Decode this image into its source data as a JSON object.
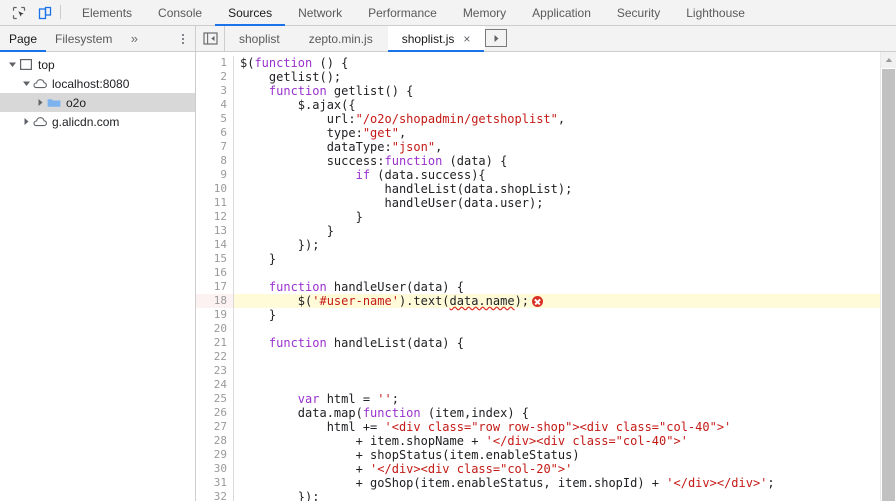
{
  "toolbar": {
    "inspect_icon": "inspect-element-icon",
    "device_icon": "device-toolbar-icon"
  },
  "main_tabs": [
    {
      "label": "Elements",
      "active": false
    },
    {
      "label": "Console",
      "active": false
    },
    {
      "label": "Sources",
      "active": true
    },
    {
      "label": "Network",
      "active": false
    },
    {
      "label": "Performance",
      "active": false
    },
    {
      "label": "Memory",
      "active": false
    },
    {
      "label": "Application",
      "active": false
    },
    {
      "label": "Security",
      "active": false
    },
    {
      "label": "Lighthouse",
      "active": false
    }
  ],
  "navigator": {
    "tabs": [
      {
        "label": "Page",
        "active": true
      },
      {
        "label": "Filesystem",
        "active": false
      }
    ],
    "more_label": "»",
    "menu_icon": "more-options-icon"
  },
  "file_tabs": {
    "panel_toggle_icon": "show-navigator-icon",
    "overflow_icon": "tabs-overflow-right-icon",
    "items": [
      {
        "label": "shoplist",
        "active": false,
        "closable": false
      },
      {
        "label": "zepto.min.js",
        "active": false,
        "closable": false
      },
      {
        "label": "shoplist.js",
        "active": true,
        "closable": true
      }
    ],
    "close_glyph": "×"
  },
  "tree": [
    {
      "label": "top",
      "depth": 0,
      "icon": "frame-icon",
      "expanded": true,
      "selected": false
    },
    {
      "label": "localhost:8080",
      "depth": 1,
      "icon": "cloud-icon",
      "expanded": true,
      "selected": false
    },
    {
      "label": "o2o",
      "depth": 2,
      "icon": "folder-icon",
      "expanded": false,
      "selected": true
    },
    {
      "label": "g.alicdn.com",
      "depth": 1,
      "icon": "cloud-icon",
      "expanded": false,
      "selected": false
    }
  ],
  "editor": {
    "highlighted_line": 18,
    "error_line": 18,
    "error_badge_icon": "error-circle-icon",
    "lines": [
      {
        "n": 1,
        "tokens": [
          {
            "t": "$(",
            "c": "plain"
          },
          {
            "t": "function",
            "c": "kw"
          },
          {
            "t": " () {",
            "c": "plain"
          }
        ]
      },
      {
        "n": 2,
        "tokens": [
          {
            "t": "    getlist();",
            "c": "plain"
          }
        ]
      },
      {
        "n": 3,
        "tokens": [
          {
            "t": "    ",
            "c": "plain"
          },
          {
            "t": "function",
            "c": "kw"
          },
          {
            "t": " getlist() {",
            "c": "plain"
          }
        ]
      },
      {
        "n": 4,
        "tokens": [
          {
            "t": "        $.ajax({",
            "c": "plain"
          }
        ]
      },
      {
        "n": 5,
        "tokens": [
          {
            "t": "            url:",
            "c": "plain"
          },
          {
            "t": "\"/o2o/shopadmin/getshoplist\"",
            "c": "str"
          },
          {
            "t": ",",
            "c": "plain"
          }
        ]
      },
      {
        "n": 6,
        "tokens": [
          {
            "t": "            type:",
            "c": "plain"
          },
          {
            "t": "\"get\"",
            "c": "str"
          },
          {
            "t": ",",
            "c": "plain"
          }
        ]
      },
      {
        "n": 7,
        "tokens": [
          {
            "t": "            dataType:",
            "c": "plain"
          },
          {
            "t": "\"json\"",
            "c": "str"
          },
          {
            "t": ",",
            "c": "plain"
          }
        ]
      },
      {
        "n": 8,
        "tokens": [
          {
            "t": "            success:",
            "c": "plain"
          },
          {
            "t": "function",
            "c": "kw"
          },
          {
            "t": " (data) {",
            "c": "plain"
          }
        ]
      },
      {
        "n": 9,
        "tokens": [
          {
            "t": "                ",
            "c": "plain"
          },
          {
            "t": "if",
            "c": "kw"
          },
          {
            "t": " (data.success){",
            "c": "plain"
          }
        ]
      },
      {
        "n": 10,
        "tokens": [
          {
            "t": "                    handleList(data.shopList);",
            "c": "plain"
          }
        ]
      },
      {
        "n": 11,
        "tokens": [
          {
            "t": "                    handleUser(data.user);",
            "c": "plain"
          }
        ]
      },
      {
        "n": 12,
        "tokens": [
          {
            "t": "                }",
            "c": "plain"
          }
        ]
      },
      {
        "n": 13,
        "tokens": [
          {
            "t": "            }",
            "c": "plain"
          }
        ]
      },
      {
        "n": 14,
        "tokens": [
          {
            "t": "        });",
            "c": "plain"
          }
        ]
      },
      {
        "n": 15,
        "tokens": [
          {
            "t": "    }",
            "c": "plain"
          }
        ]
      },
      {
        "n": 16,
        "tokens": []
      },
      {
        "n": 17,
        "tokens": [
          {
            "t": "    ",
            "c": "plain"
          },
          {
            "t": "function",
            "c": "kw"
          },
          {
            "t": " handleUser(data) {",
            "c": "plain"
          }
        ]
      },
      {
        "n": 18,
        "tokens": [
          {
            "t": "        $(",
            "c": "plain"
          },
          {
            "t": "'#user-name'",
            "c": "str"
          },
          {
            "t": ").text(",
            "c": "plain"
          },
          {
            "t": "data.name",
            "c": "plain err-underline"
          },
          {
            "t": ");",
            "c": "plain"
          }
        ]
      },
      {
        "n": 19,
        "tokens": [
          {
            "t": "    }",
            "c": "plain"
          }
        ]
      },
      {
        "n": 20,
        "tokens": []
      },
      {
        "n": 21,
        "tokens": [
          {
            "t": "    ",
            "c": "plain"
          },
          {
            "t": "function",
            "c": "kw"
          },
          {
            "t": " handleList(data) {",
            "c": "plain"
          }
        ]
      },
      {
        "n": 22,
        "tokens": []
      },
      {
        "n": 23,
        "tokens": []
      },
      {
        "n": 24,
        "tokens": []
      },
      {
        "n": 25,
        "tokens": [
          {
            "t": "        ",
            "c": "plain"
          },
          {
            "t": "var",
            "c": "kw"
          },
          {
            "t": " html = ",
            "c": "plain"
          },
          {
            "t": "''",
            "c": "str"
          },
          {
            "t": ";",
            "c": "plain"
          }
        ]
      },
      {
        "n": 26,
        "tokens": [
          {
            "t": "        data.map(",
            "c": "plain"
          },
          {
            "t": "function",
            "c": "kw"
          },
          {
            "t": " (item,index) {",
            "c": "plain"
          }
        ]
      },
      {
        "n": 27,
        "tokens": [
          {
            "t": "            html += ",
            "c": "plain"
          },
          {
            "t": "'<div class=\"row row-shop\"><div class=\"col-40\">'",
            "c": "str"
          }
        ]
      },
      {
        "n": 28,
        "tokens": [
          {
            "t": "                + item.shopName + ",
            "c": "plain"
          },
          {
            "t": "'</div><div class=\"col-40\">'",
            "c": "str"
          }
        ]
      },
      {
        "n": 29,
        "tokens": [
          {
            "t": "                + shopStatus(item.enableStatus)",
            "c": "plain"
          }
        ]
      },
      {
        "n": 30,
        "tokens": [
          {
            "t": "                + ",
            "c": "plain"
          },
          {
            "t": "'</div><div class=\"col-20\">'",
            "c": "str"
          }
        ]
      },
      {
        "n": 31,
        "tokens": [
          {
            "t": "                + goShop(item.enableStatus, item.shopId) + ",
            "c": "plain"
          },
          {
            "t": "'</div></div>'",
            "c": "str"
          },
          {
            "t": ";",
            "c": "plain"
          }
        ]
      },
      {
        "n": 32,
        "tokens": [
          {
            "t": "        });",
            "c": "plain"
          }
        ]
      }
    ]
  },
  "colors": {
    "accent": "#1a73e8",
    "error": "#d93025",
    "highlight": "#fffbd8",
    "string": "#c41a16",
    "keyword": "#9a32cd",
    "folder": "#7cb3ef"
  }
}
